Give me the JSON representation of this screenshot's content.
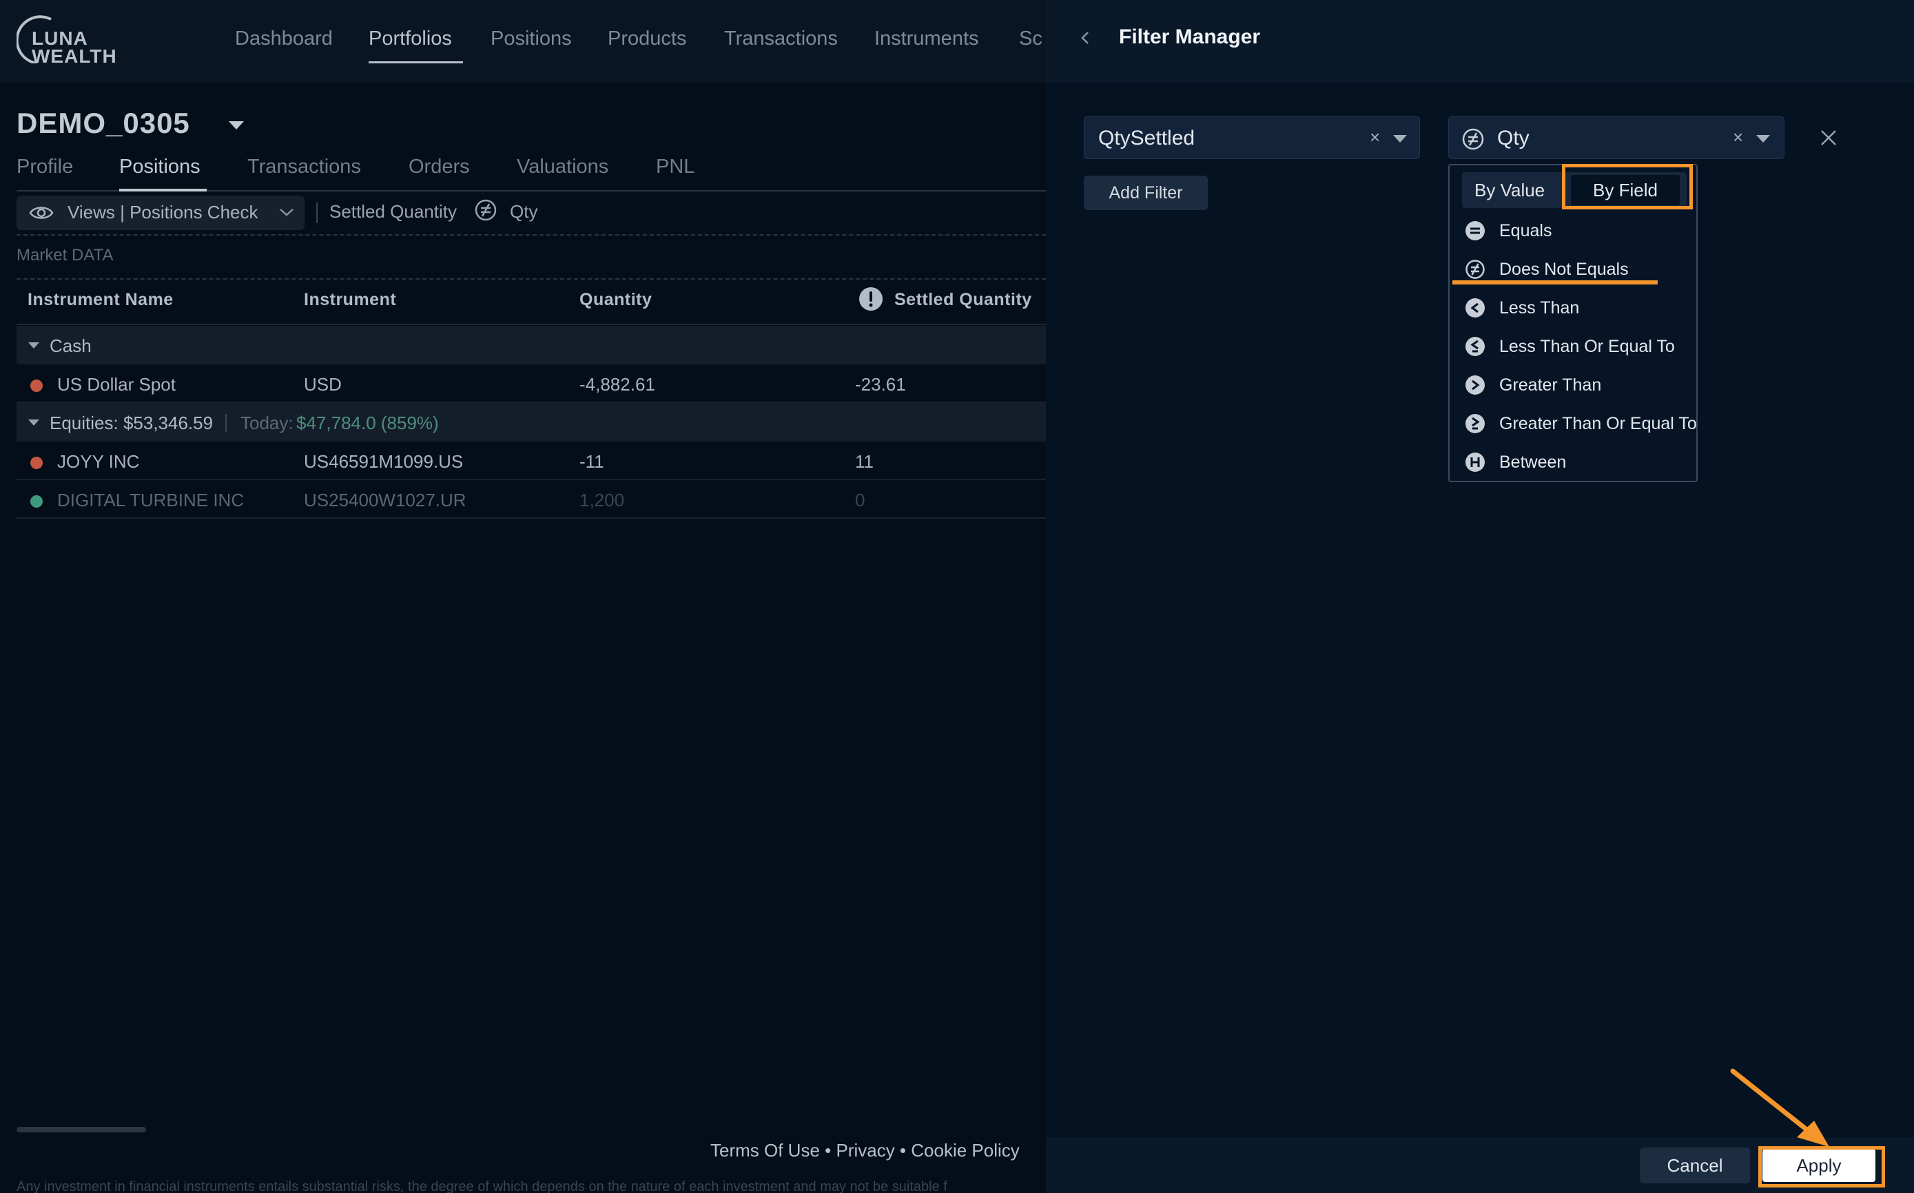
{
  "app": {
    "logo": {
      "line1": "LUNA",
      "line2": "WEALTH"
    },
    "nav": [
      "Dashboard",
      "Portfolios",
      "Positions",
      "Products",
      "Transactions",
      "Instruments",
      "Sc"
    ],
    "portfolio_name": "DEMO_0305",
    "subtabs": [
      "Profile",
      "Positions",
      "Transactions",
      "Orders",
      "Valuations",
      "PNL"
    ],
    "views_label": "Views | Positions Check",
    "active_filter": {
      "field": "Settled Quantity",
      "operator_icon": "not-equal-icon",
      "value": "Qty"
    },
    "section_label": "Market DATA",
    "table": {
      "columns": [
        "Instrument Name",
        "Instrument",
        "Quantity",
        "Settled Quantity"
      ],
      "groups": [
        {
          "label": "Cash",
          "rows": [
            {
              "name": "US Dollar Spot",
              "instrument": "USD",
              "quantity": "-4,882.61",
              "settled": "-23.61",
              "status_color": "#c4573f"
            }
          ]
        },
        {
          "label": "Equities: $53,346.59",
          "today_label": "Today:",
          "today_value": "$47,784.0 (859%)",
          "rows": [
            {
              "name": "JOYY INC",
              "instrument": "US46591M1099.US",
              "quantity": "-11",
              "settled": "11",
              "status_color": "#c4573f"
            },
            {
              "name": "DIGITAL TURBINE INC",
              "instrument": "US25400W1027.UR",
              "quantity": "1,200",
              "settled": "0",
              "status_color": "#3e9a7c"
            }
          ]
        }
      ]
    },
    "footer": {
      "links": "Terms Of Use • Privacy • Cookie Policy",
      "disclaimer": "Any investment in financial instruments entails substantial risks, the degree of which depends on the nature of each investment and may not be suitable f"
    }
  },
  "filter_manager": {
    "title": "Filter Manager",
    "field_select": {
      "value": "QtySettled",
      "clear": "×"
    },
    "compare_select": {
      "value": "Qty",
      "clear": "×",
      "icon": "not-equal-icon"
    },
    "add_filter_label": "Add Filter",
    "mode_tabs": {
      "by_value": "By Value",
      "by_field": "By Field",
      "selected": "By Field"
    },
    "operators": [
      {
        "label": "Equals",
        "icon": "equals-icon"
      },
      {
        "label": "Does Not Equals",
        "icon": "not-equal-icon"
      },
      {
        "label": "Less Than",
        "icon": "less-than-icon"
      },
      {
        "label": "Less Than Or Equal To",
        "icon": "less-than-equal-icon"
      },
      {
        "label": "Greater Than",
        "icon": "greater-than-icon"
      },
      {
        "label": "Greater Than Or Equal To",
        "icon": "greater-than-equal-icon"
      },
      {
        "label": "Between",
        "icon": "between-icon"
      }
    ],
    "selected_operator": "Does Not Equals",
    "cancel_label": "Cancel",
    "apply_label": "Apply"
  },
  "colors": {
    "accent_annotation": "#f5962c",
    "negative_status": "#c4573f",
    "positive_status": "#3e9a7c",
    "gain_text": "#4e8f7a"
  }
}
